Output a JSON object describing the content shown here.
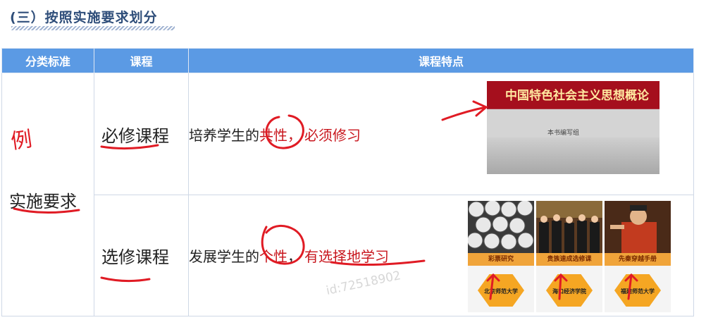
{
  "heading": "(三）按照实施要求划分",
  "table": {
    "headers": [
      "分类标准",
      "课程",
      "课程特点"
    ],
    "category": {
      "annotation": "例",
      "label": "实施要求"
    },
    "rows": [
      {
        "course": "必修课程",
        "feature_prefix": "培养学生的",
        "feature_highlight": "共性",
        "feature_sep": "，",
        "feature_suffix": "必须修习"
      },
      {
        "course": "选修课程",
        "feature_prefix": "发展学生的",
        "feature_highlight": "个性",
        "feature_sep": "，",
        "feature_suffix": "有选择地学习"
      }
    ]
  },
  "book": {
    "title": "中国特色社会主义思想概论",
    "publisher": "本书编写组"
  },
  "cards": [
    {
      "title": "彩票研究",
      "school": "北京师范大学"
    },
    {
      "title": "贵族速成选修课",
      "school": "海口经济学院"
    },
    {
      "title": "先秦穿越手册",
      "school": "福建师范大学"
    }
  ],
  "watermark": "id:72518902",
  "colors": {
    "header_bg": "#5b9ae4",
    "accent_red": "#c8161d",
    "ink": "#e01b24",
    "hex": "#f5a623"
  }
}
